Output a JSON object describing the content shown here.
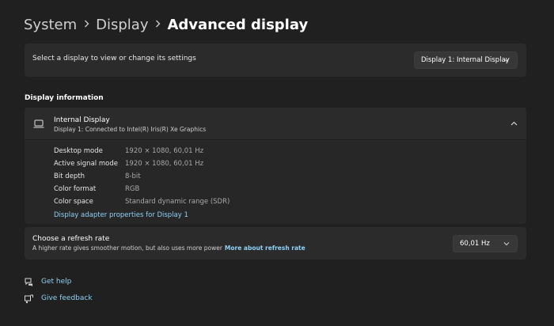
{
  "breadcrumb": {
    "items": [
      "System",
      "Display",
      "Advanced display"
    ],
    "separator_icon": "chevron-right-icon"
  },
  "select_display": {
    "label": "Select a display to view or change its settings",
    "dropdown_value": "Display 1: Internal Display"
  },
  "display_information": {
    "section_title": "Display information",
    "name": "Internal Display",
    "subtitle": "Display 1: Connected to Intel(R) Iris(R) Xe Graphics",
    "icon": "monitor-icon",
    "expanded": true,
    "properties": [
      {
        "label": "Desktop mode",
        "value": "1920 × 1080, 60,01 Hz"
      },
      {
        "label": "Active signal mode",
        "value": "1920 × 1080, 60,01 Hz"
      },
      {
        "label": "Bit depth",
        "value": "8-bit"
      },
      {
        "label": "Color format",
        "value": "RGB"
      },
      {
        "label": "Color space",
        "value": "Standard dynamic range (SDR)"
      }
    ],
    "adapter_link": "Display adapter properties for Display 1"
  },
  "refresh_rate": {
    "title": "Choose a refresh rate",
    "description": "A higher rate gives smoother motion, but also uses more power",
    "more_link": "More about refresh rate",
    "dropdown_value": "60,01 Hz"
  },
  "footer": {
    "get_help": "Get help",
    "give_feedback": "Give feedback"
  },
  "colors": {
    "background": "#202020",
    "card": "#2b2b2b",
    "accent_link": "#8fd0f5"
  }
}
